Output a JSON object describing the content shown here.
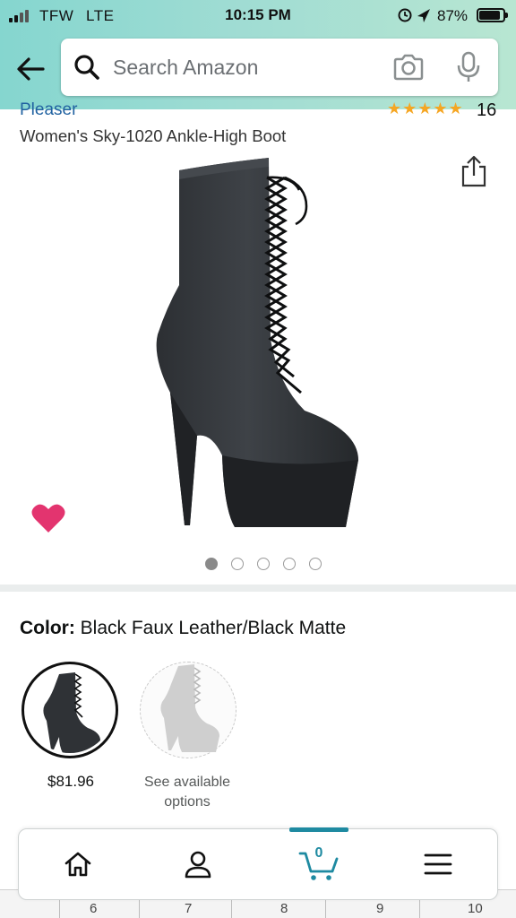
{
  "status_bar": {
    "carrier": "TFW",
    "network": "LTE",
    "time": "10:15 PM",
    "battery_percent": "87%",
    "battery_level": 0.87
  },
  "header": {
    "back_icon": "back-arrow-icon",
    "search_placeholder": "Search Amazon",
    "search_icon": "search-icon",
    "camera_icon": "camera-icon",
    "mic_icon": "microphone-icon",
    "gradient_colors": [
      "#85d6cf",
      "#b8e6d2"
    ]
  },
  "product": {
    "brand": "Pleaser",
    "rating_stars": "★★★★★",
    "rating": 4.5,
    "review_count": "16",
    "title": "Women's Sky-1020 Ankle-High Boot",
    "image_count": 5,
    "active_image_index": 0,
    "wishlist_color": "#e3346f"
  },
  "color_selector": {
    "label": "Color:",
    "value": "Black Faux Leather/Black Matte",
    "options": [
      {
        "price": "$81.96"
      },
      {
        "price": "See available options"
      }
    ]
  },
  "bottom_nav": {
    "cart_count": "0",
    "accent_color": "#1e8aa1",
    "items": [
      "home-icon",
      "account-icon",
      "cart-icon",
      "menu-icon"
    ]
  },
  "ruler": {
    "labels": [
      "6",
      "7",
      "8",
      "9",
      "10"
    ]
  }
}
